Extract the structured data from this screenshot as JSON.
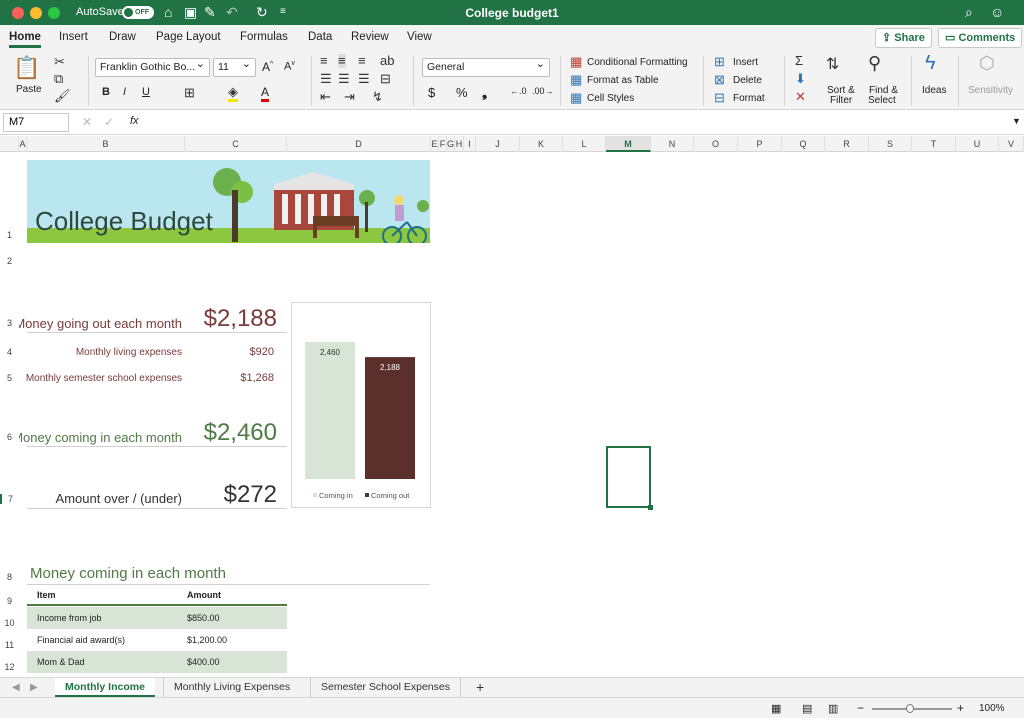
{
  "window": {
    "title": "College budget1",
    "autosave_label": "AutoSave",
    "autosave_state": "OFF"
  },
  "ribbon_tabs": [
    "Home",
    "Insert",
    "Draw",
    "Page Layout",
    "Formulas",
    "Data",
    "Review",
    "View"
  ],
  "active_tab": "Home",
  "header_buttons": {
    "share": "Share",
    "comments": "Comments"
  },
  "ribbon": {
    "paste": "Paste",
    "font_name": "Franklin Gothic Bo...",
    "font_size": "11",
    "number_format": "General",
    "conditional_formatting": "Conditional Formatting",
    "format_as_table": "Format as Table",
    "cell_styles": "Cell Styles",
    "insert": "Insert",
    "delete": "Delete",
    "format": "Format",
    "sort_filter": "Sort &",
    "sort_filter2": "Filter",
    "find_select": "Find &",
    "find_select2": "Select",
    "ideas": "Ideas",
    "sensitivity": "Sensitivity"
  },
  "formula_bar": {
    "name_box": "M7",
    "fx": "fx",
    "content": ""
  },
  "columns": [
    "A",
    "B",
    "C",
    "D",
    "E",
    "F",
    "G",
    "H",
    "I",
    "J",
    "K",
    "L",
    "M",
    "N",
    "O",
    "P",
    "Q",
    "R",
    "S",
    "T",
    "U",
    "V"
  ],
  "rows": [
    "1",
    "2",
    "3",
    "4",
    "5",
    "6",
    "7",
    "8",
    "9",
    "10",
    "11",
    "12"
  ],
  "sheet": {
    "banner_title": "College Budget",
    "money_out_label": "Money going out each month",
    "money_out_value": "$2,188",
    "living_label": "Monthly living expenses",
    "living_value": "$920",
    "semester_label": "Monthly semester school expenses",
    "semester_value": "$1,268",
    "money_in_label": "Money coming in each month",
    "money_in_value": "$2,460",
    "over_under_label": "Amount over / (under)",
    "over_under_value": "$272",
    "income_section_title": "Money coming in each month",
    "table_headers": [
      "Item",
      "Amount"
    ],
    "table_rows": [
      {
        "item": "Income from job",
        "amount": "$850.00"
      },
      {
        "item": "Financial aid award(s)",
        "amount": "$1,200.00"
      },
      {
        "item": "Mom & Dad",
        "amount": "$400.00"
      }
    ]
  },
  "chart_data": {
    "type": "bar",
    "categories": [
      "Coming in",
      "Coming out"
    ],
    "values": [
      2460,
      2188
    ],
    "data_labels": [
      "2,460",
      "2,188"
    ],
    "colors": [
      "#d7e4d6",
      "#5a2f2c"
    ],
    "ylim": [
      0,
      2800
    ],
    "legend": [
      "Coming in",
      "Coming out"
    ],
    "legend_position": "bottom",
    "grid": false
  },
  "sheet_tabs": [
    "Monthly Income",
    "Monthly Living Expenses",
    "Semester School Expenses"
  ],
  "active_sheet": "Monthly Income",
  "add_sheet": "+",
  "zoom": "100%",
  "colors": {
    "brand": "#217346",
    "out_text": "#7a3b3b",
    "in_text": "#4f7a44"
  }
}
